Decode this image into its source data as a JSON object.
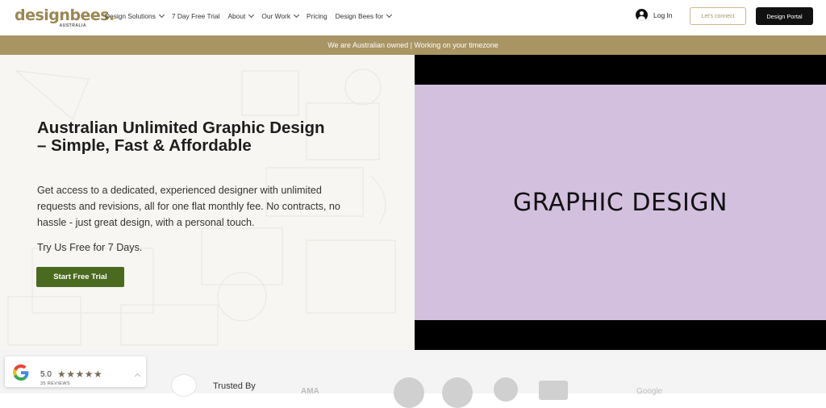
{
  "brand": {
    "name_a": "design",
    "name_b": "bees",
    "sub": "AUSTRALIA",
    "accent": "#a99463"
  },
  "nav": [
    {
      "label": "Design Solutions",
      "dropdown": true
    },
    {
      "label": "7 Day Free Trial",
      "dropdown": false
    },
    {
      "label": "About",
      "dropdown": true
    },
    {
      "label": "Our Work",
      "dropdown": true
    },
    {
      "label": "Pricing",
      "dropdown": false
    },
    {
      "label": "Design Bees for",
      "dropdown": true
    }
  ],
  "header": {
    "login": "Log In",
    "connect": "Let's connect",
    "portal": "Design Portal"
  },
  "banner": {
    "text": "We are Australian owned | Working on your timezone"
  },
  "hero": {
    "title": "Australian Unlimited Graphic Design – Simple, Fast & Affordable",
    "description": "Get access to a dedicated, experienced designer with unlimited requests and revisions, all for one flat monthly fee. No contracts, no hassle - just great design, with a personal touch.",
    "free_text": "Try Us Free for 7 Days.",
    "cta": "Start Free Trial",
    "cta_color": "#4a6a1f"
  },
  "video": {
    "text": "GRAPHIC DESIGN",
    "bg": "#d3c0de"
  },
  "reviews": {
    "rating": "5.0",
    "stars": "★★★★★",
    "count": "35 REVIEWS"
  },
  "trusted": {
    "label": "Trusted By",
    "partners": [
      "AMA",
      "Google"
    ]
  }
}
